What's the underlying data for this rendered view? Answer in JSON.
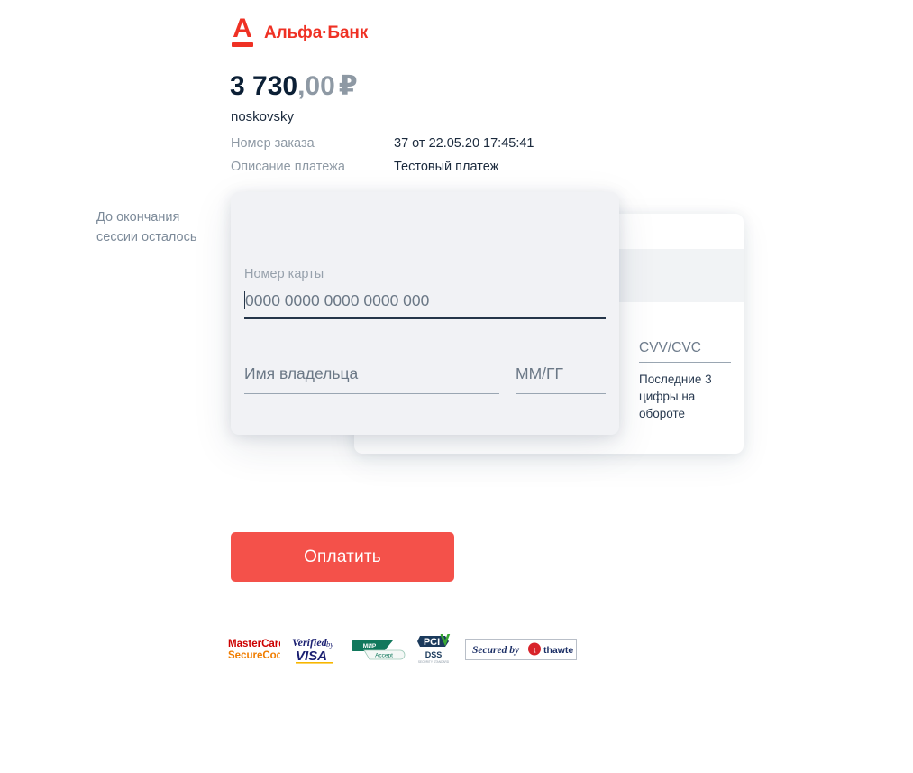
{
  "brand": {
    "logo_letter": "А",
    "logo_name": "Альфа·Банк",
    "accent_color": "#ef3124"
  },
  "payment": {
    "amount_main": "3 730",
    "amount_fraction": ",00",
    "currency_symbol": "₽",
    "merchant": "noskovsky",
    "details": [
      {
        "label": "Номер заказа",
        "value": "37 от 22.05.20 17:45:41"
      },
      {
        "label": "Описание платежа",
        "value": "Тестовый платеж"
      }
    ]
  },
  "session": {
    "label": "До окончания сессии осталось"
  },
  "card_form": {
    "card_number": {
      "label": "Номер карты",
      "placeholder": "0000 0000 0000 0000 000",
      "value": "",
      "focused": true
    },
    "holder": {
      "placeholder": "Имя владельца",
      "value": ""
    },
    "expiry": {
      "placeholder": "ММ/ГГ",
      "value": ""
    },
    "cvv": {
      "label": "CVV/CVC",
      "value": "",
      "hint": "Последние 3 цифры на обороте"
    }
  },
  "actions": {
    "pay_label": "Оплатить"
  },
  "security_badges": [
    {
      "name": "mastercard-securecode-badge",
      "line1": "MasterCard.",
      "line2": "SecureCode."
    },
    {
      "name": "verified-by-visa-badge",
      "line1": "Verified",
      "line2": "by",
      "line3": "VISA"
    },
    {
      "name": "mir-accept-badge",
      "line1": "МИР",
      "line2": "Accept"
    },
    {
      "name": "pci-dss-badge",
      "line1": "PCI",
      "line2": "DSS",
      "line3": "SECURITY STANDARD"
    },
    {
      "name": "thawte-secured-badge",
      "line1": "Secured by",
      "line2": "thawte"
    }
  ],
  "colors": {
    "page_background": "#ffffff",
    "modal_background": "#f1f2f5",
    "card_background": "#ffffff",
    "card_stripe": "#f1f3f5",
    "text_dark": "#1b2a3d",
    "text_muted": "#8e99a4",
    "button_red": "#f4514a",
    "underline_active": "#253549",
    "underline_idle": "#9aa6b2"
  }
}
